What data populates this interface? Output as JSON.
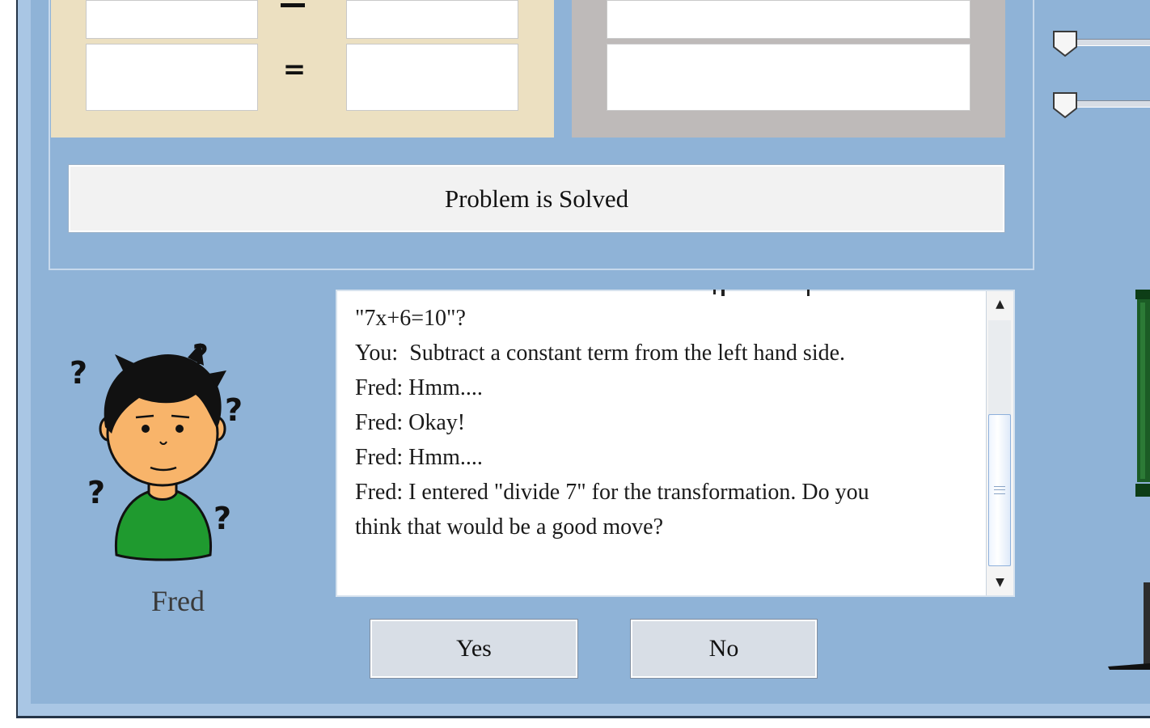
{
  "equation": {
    "equals_sign": "="
  },
  "status_button": {
    "label": "Problem is Solved"
  },
  "agent": {
    "name": "Fred",
    "icon": "confused-student-avatar"
  },
  "chat": {
    "lines": [
      "\"7x+6=10\"?",
      "You:  Subtract a constant term from the left hand side.",
      "Fred: Hmm....",
      "Fred: Okay!",
      "Fred: Hmm....",
      "Fred: I entered \"divide 7\" for the transformation. Do you",
      "think that would be a good move?"
    ],
    "scroll_up_icon": "▲",
    "scroll_down_icon": "▼"
  },
  "buttons": {
    "yes_label": "Yes",
    "no_label": "No"
  },
  "colors": {
    "background": "#8fb3d7",
    "left_side_panel": "#ece0c1",
    "right_side_panel": "#bebab9",
    "shirt": "#1f9a2f"
  }
}
